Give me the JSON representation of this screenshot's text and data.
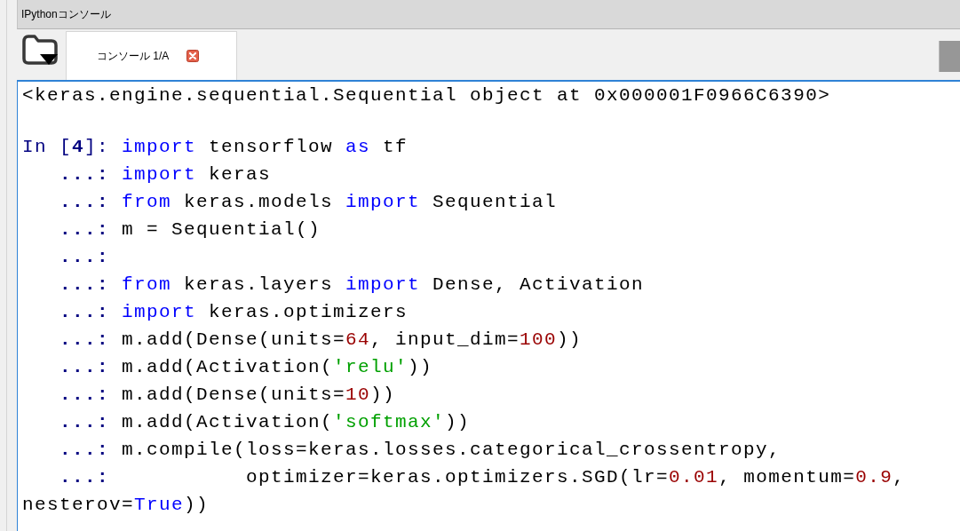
{
  "window": {
    "title": "IPythonコンソール"
  },
  "tabs": [
    {
      "label": "コンソール 1/A",
      "selected": true,
      "closable": true
    }
  ],
  "console": {
    "lines": [
      {
        "kind": "output",
        "tokens": [
          {
            "kind": "text",
            "text": "<keras.engine.sequential.Sequential object at 0x000001F0966C6390>"
          }
        ]
      },
      {
        "kind": "blank"
      },
      {
        "kind": "input",
        "prompt": "In [**4**]:",
        "tokens": [
          {
            "kind": "keyword",
            "text": "import"
          },
          {
            "kind": "text",
            "text": " tensorflow "
          },
          {
            "kind": "keyword",
            "text": "as"
          },
          {
            "kind": "text",
            "text": " tf"
          }
        ]
      },
      {
        "kind": "continuation",
        "prompt": "...:",
        "tokens": [
          {
            "kind": "keyword",
            "text": "import"
          },
          {
            "kind": "text",
            "text": " keras"
          }
        ]
      },
      {
        "kind": "continuation",
        "prompt": "...:",
        "tokens": [
          {
            "kind": "keyword",
            "text": "from"
          },
          {
            "kind": "text",
            "text": " keras.models "
          },
          {
            "kind": "keyword",
            "text": "import"
          },
          {
            "kind": "text",
            "text": " Sequential"
          }
        ]
      },
      {
        "kind": "continuation",
        "prompt": "...:",
        "tokens": [
          {
            "kind": "text",
            "text": "m = Sequential()"
          }
        ]
      },
      {
        "kind": "continuation",
        "prompt": "...:"
      },
      {
        "kind": "continuation",
        "prompt": "...:",
        "tokens": [
          {
            "kind": "keyword",
            "text": "from"
          },
          {
            "kind": "text",
            "text": " keras.layers "
          },
          {
            "kind": "keyword",
            "text": "import"
          },
          {
            "kind": "text",
            "text": " Dense, Activation"
          }
        ]
      },
      {
        "kind": "continuation",
        "prompt": "...:",
        "tokens": [
          {
            "kind": "keyword",
            "text": "import"
          },
          {
            "kind": "text",
            "text": " keras.optimizers"
          }
        ]
      },
      {
        "kind": "continuation",
        "prompt": "...:",
        "tokens": [
          {
            "kind": "text",
            "text": "m.add(Dense(units="
          },
          {
            "kind": "number",
            "text": "64"
          },
          {
            "kind": "text",
            "text": ", input_dim="
          },
          {
            "kind": "number",
            "text": "100"
          },
          {
            "kind": "text",
            "text": "))"
          }
        ]
      },
      {
        "kind": "continuation",
        "prompt": "...:",
        "tokens": [
          {
            "kind": "text",
            "text": "m.add(Activation("
          },
          {
            "kind": "string",
            "text": "'relu'"
          },
          {
            "kind": "text",
            "text": "))"
          }
        ]
      },
      {
        "kind": "continuation",
        "prompt": "...:",
        "tokens": [
          {
            "kind": "text",
            "text": "m.add(Dense(units="
          },
          {
            "kind": "number",
            "text": "10"
          },
          {
            "kind": "text",
            "text": "))"
          }
        ]
      },
      {
        "kind": "continuation",
        "prompt": "...:",
        "tokens": [
          {
            "kind": "text",
            "text": "m.add(Activation("
          },
          {
            "kind": "string",
            "text": "'softmax'"
          },
          {
            "kind": "text",
            "text": "))"
          }
        ]
      },
      {
        "kind": "continuation",
        "prompt": "...:",
        "tokens": [
          {
            "kind": "text",
            "text": "m.compile(loss=keras.losses.categorical_crossentropy,"
          }
        ]
      },
      {
        "kind": "continuation",
        "prompt": "...:",
        "tokens": [
          {
            "kind": "text",
            "text": "          optimizer=keras.optimizers.SGD(lr="
          },
          {
            "kind": "number",
            "text": "0.01"
          },
          {
            "kind": "text",
            "text": ", momentum="
          },
          {
            "kind": "number",
            "text": "0.9"
          },
          {
            "kind": "text",
            "text": ","
          }
        ]
      },
      {
        "kind": "wrap",
        "tokens": [
          {
            "kind": "text",
            "text": "nesterov="
          },
          {
            "kind": "keyword",
            "text": "True"
          },
          {
            "kind": "text",
            "text": "))"
          }
        ]
      }
    ]
  }
}
